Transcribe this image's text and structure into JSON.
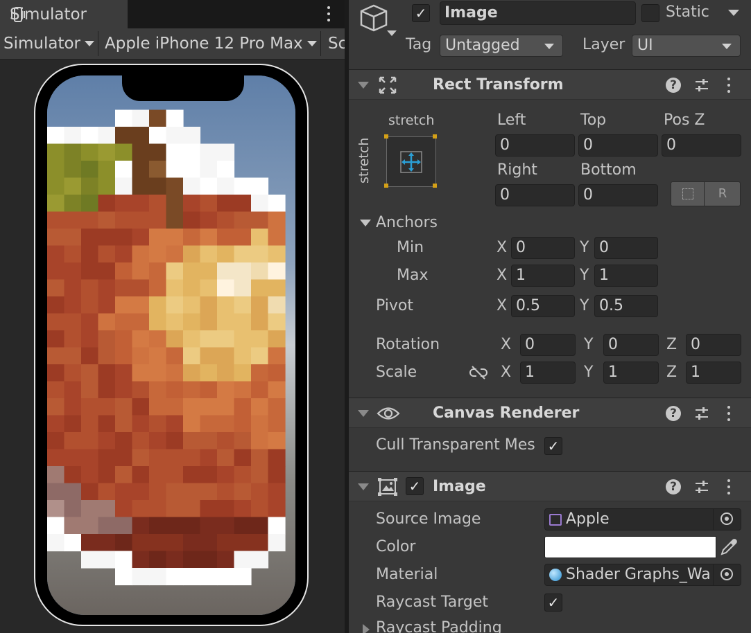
{
  "simulator": {
    "tab_label": "Simulator",
    "toolbar": {
      "mode_dropdown": "Simulator",
      "device_dropdown": "Apple iPhone 12 Pro Max",
      "scale_dropdown_partial": "Sc"
    }
  },
  "inspector": {
    "object": {
      "active": true,
      "name": "Image",
      "static_label": "Static",
      "static": false,
      "tag_label": "Tag",
      "tag_value": "Untagged",
      "layer_label": "Layer",
      "layer_value": "UI"
    },
    "rect_transform": {
      "title": "Rect Transform",
      "anchor_preset_horizontal": "stretch",
      "anchor_preset_vertical": "stretch",
      "col_labels": [
        "Left",
        "Top",
        "Pos Z"
      ],
      "row1_values": [
        "0",
        "0",
        "0"
      ],
      "col_labels2": [
        "Right",
        "Bottom"
      ],
      "row2_values": [
        "0",
        "0"
      ],
      "raw_edit_button": "R",
      "anchors_label": "Anchors",
      "min_label": "Min",
      "max_label": "Max",
      "pivot_label": "Pivot",
      "x_label": "X",
      "y_label": "Y",
      "z_label": "Z",
      "anchor_min": {
        "x": "0",
        "y": "0"
      },
      "anchor_max": {
        "x": "1",
        "y": "1"
      },
      "pivot": {
        "x": "0.5",
        "y": "0.5"
      },
      "rotation_label": "Rotation",
      "rotation": {
        "x": "0",
        "y": "0",
        "z": "0"
      },
      "scale_label": "Scale",
      "scale": {
        "x": "1",
        "y": "1",
        "z": "1"
      }
    },
    "canvas_renderer": {
      "title": "Canvas Renderer",
      "cull_label": "Cull Transparent Mes",
      "cull": true
    },
    "image": {
      "title": "Image",
      "enabled": true,
      "source_image_label": "Source Image",
      "source_image": "Apple",
      "color_label": "Color",
      "color": "#ffffff",
      "material_label": "Material",
      "material": "Shader Graphs_Wa",
      "raycast_target_label": "Raycast Target",
      "raycast_target": true,
      "raycast_padding_label": "Raycast Padding"
    }
  },
  "colors": {
    "accent_blue": "#2a9fd6",
    "anchor_gold": "#d4a017",
    "sky": "#6a88b8"
  }
}
